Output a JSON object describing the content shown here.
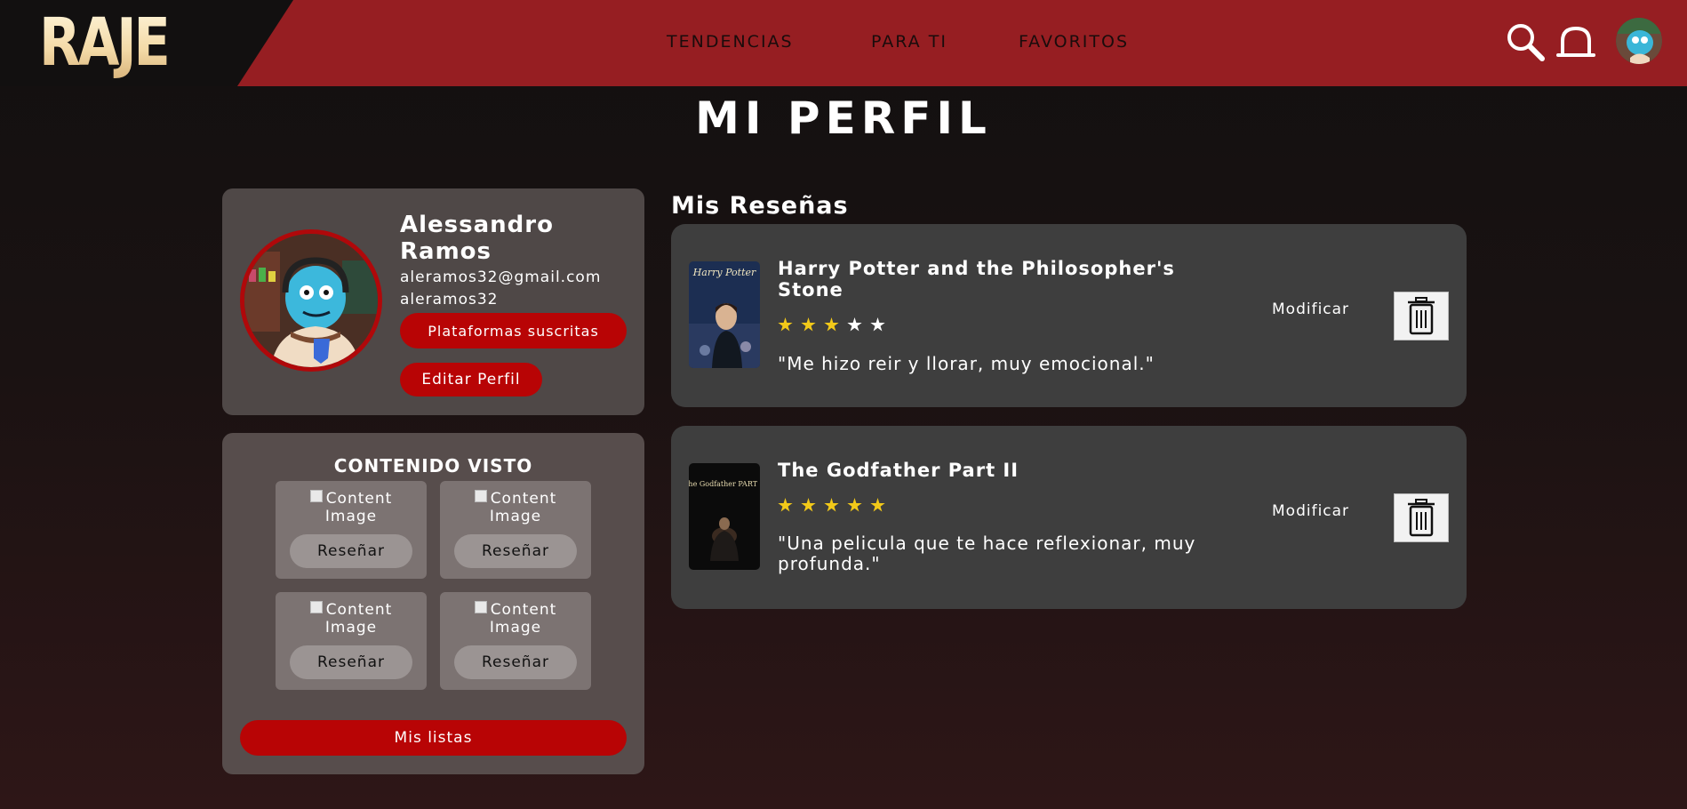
{
  "header": {
    "logo": "RAJE",
    "nav": [
      "TENDENCIAS",
      "PARA TI",
      "FAVORITOS"
    ],
    "icons": [
      "search-icon",
      "bell-icon",
      "avatar"
    ]
  },
  "page_title": "MI PERFIL",
  "profile": {
    "name": "Alessandro Ramos",
    "email": "aleramos32@gmail.com",
    "username": "aleramos32",
    "platforms_button": "Plataformas suscritas",
    "edit_button": "Editar Perfil"
  },
  "watched": {
    "title": "CONTENIDO VISTO",
    "items": [
      {
        "image_alt": "Content Image",
        "button": "Reseñar"
      },
      {
        "image_alt": "Content Image",
        "button": "Reseñar"
      },
      {
        "image_alt": "Content Image",
        "button": "Reseñar"
      },
      {
        "image_alt": "Content Image",
        "button": "Reseñar"
      }
    ],
    "lists_button": "Mis listas"
  },
  "reviews": {
    "title": "Mis Reseñas",
    "items": [
      {
        "title": "Harry Potter and the Philosopher's Stone",
        "rating": 3,
        "max_rating": 5,
        "text": "\"Me hizo reir y llorar, muy emocional.\"",
        "modify_label": "Modificar",
        "poster_text": "Harry Potter"
      },
      {
        "title": "The Godfather Part II",
        "rating": 5,
        "max_rating": 5,
        "text": "\"Una pelicula que te hace reflexionar, muy profunda.\"",
        "modify_label": "Modificar",
        "poster_text": "The Godfather PART II"
      }
    ]
  },
  "colors": {
    "header_bg": "#961e22",
    "accent_red": "#b80405",
    "star_on": "#f2c919",
    "card_bg": "#3e3e3e"
  }
}
